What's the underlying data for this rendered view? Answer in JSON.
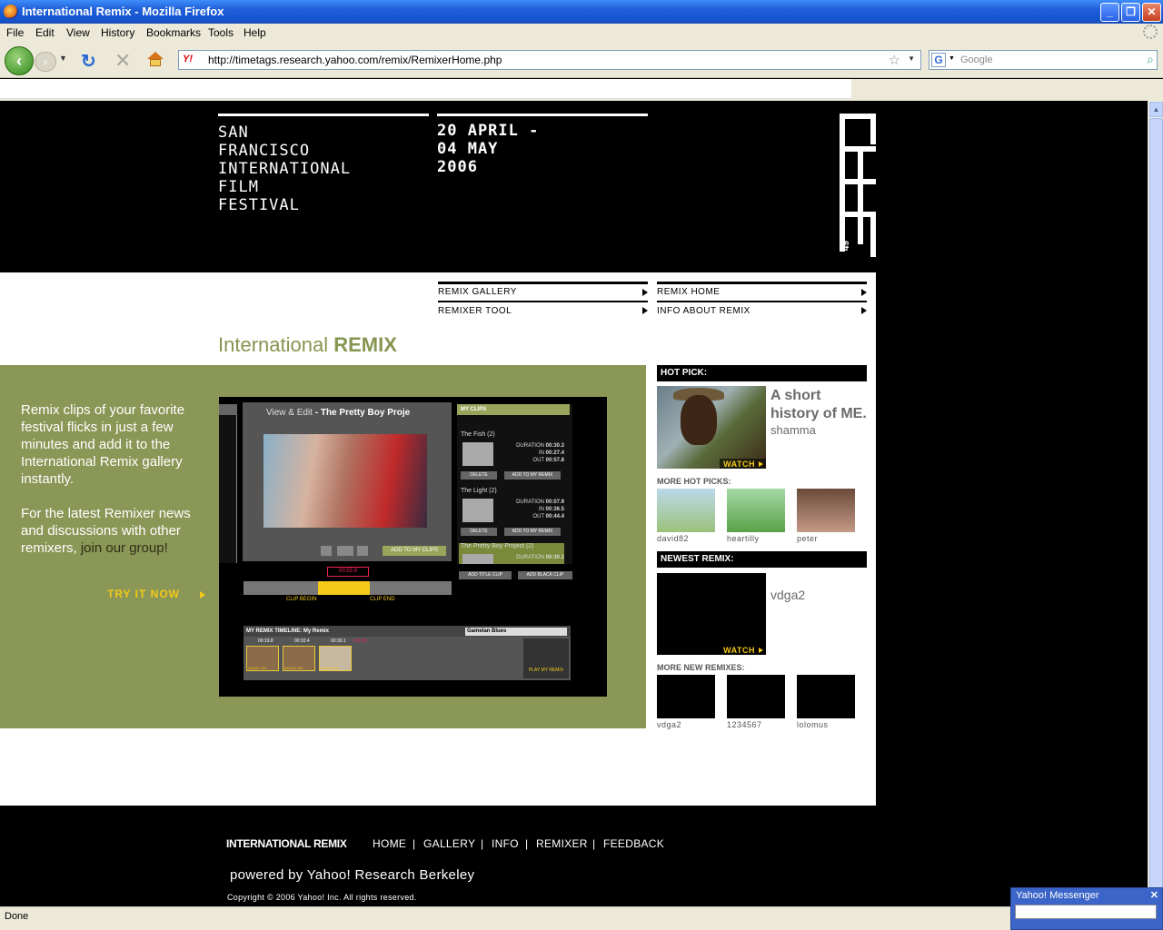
{
  "window": {
    "title": "International Remix - Mozilla Firefox",
    "controls": [
      "_",
      "❐",
      "✕"
    ]
  },
  "menu": [
    "File",
    "Edit",
    "View",
    "History",
    "Bookmarks",
    "Tools",
    "Help"
  ],
  "nav": {
    "url": "http://timetags.research.yahoo.com/remix/RemixerHome.php",
    "search_placeholder": "Google"
  },
  "header": {
    "festival_lines": [
      "SAN",
      "FRANCISCO",
      "INTERNATIONAL",
      "FILM",
      "FESTIVAL"
    ],
    "date_lines": [
      "20 APRIL -",
      "04 MAY",
      "2006"
    ],
    "logo_number": "49"
  },
  "site_nav": [
    {
      "label": "REMIX GALLERY"
    },
    {
      "label": "REMIXER TOOL"
    },
    {
      "label": "REMIX HOME"
    },
    {
      "label": "INFO ABOUT REMIX"
    }
  ],
  "page_title": {
    "prefix": "International",
    "strong": "REMIX"
  },
  "promo": {
    "p1": "Remix clips of your favorite festival flicks in just a few minutes and add it to the International Remix gallery instantly.",
    "p2_before": "For the latest Remixer news and discussions with other remixers, ",
    "p2_link": "join our group!",
    "cta": "TRY IT NOW"
  },
  "tool": {
    "view_edit": "View & Edit",
    "project": "- The Pretty Boy Proje",
    "add_to_my_clips": "ADD TO MY CLIPS",
    "my_clips": "MY CLIPS",
    "clips": [
      {
        "name": "The Fish (2)",
        "duration": "00:30.3",
        "in": "00:27.4",
        "out": "00:57.8"
      },
      {
        "name": "The Light (2)",
        "duration": "00:07.9",
        "in": "00:36.5",
        "out": "00:44.4"
      },
      {
        "name": "The Pretty Boy Project (2)",
        "duration": "00:30.1",
        "in": "",
        "out": ""
      }
    ],
    "time_labels": [
      "DURATION",
      "IN",
      "OUT"
    ],
    "delete": "DELETE",
    "add_to_my_remix": "ADD TO MY REMIX",
    "add_title_clip": "ADD TITLE CLIP",
    "add_black_clip": "ADD BLACK CLIP",
    "scrub_time": "00:55.9",
    "clip_begin": "CLIP BEGIN",
    "clip_end": "CLIP END",
    "timeline_label": "MY REMIX TIMELINE:  My Remix",
    "track": "Gamelan Blues",
    "timeline_times": [
      "00:19.8",
      "00:10.4",
      "00:30.1"
    ],
    "timeline_total": "/ 01:00",
    "audio_on": "AUDIO ON",
    "play_my_remix": "PLAY MY REMIX"
  },
  "sidebar": {
    "hot_pick_heading": "HOT PICK:",
    "hot_pick_title": "A short history of ME.",
    "hot_pick_author": "shamma",
    "watch": "WATCH",
    "more_hot_heading": "MORE HOT PICKS:",
    "more_hot": [
      "david82",
      "heartilly",
      "peter"
    ],
    "newest_heading": "NEWEST REMIX:",
    "newest_author": "vdga2",
    "more_new_heading": "MORE NEW REMIXES:",
    "more_new": [
      "vdga2",
      "1234567",
      "lolomus"
    ]
  },
  "footer": {
    "brand": "INTERNATIONAL REMIX",
    "links": [
      "HOME",
      "GALLERY",
      "INFO",
      "REMIXER",
      "FEEDBACK"
    ],
    "separator": "|",
    "powered": "powered by Yahoo! Research Berkeley",
    "copyright": "Copyright © 2006 Yahoo! Inc. All rights reserved."
  },
  "status": {
    "text": "Done",
    "messenger_title": "Yahoo! Messenger"
  }
}
